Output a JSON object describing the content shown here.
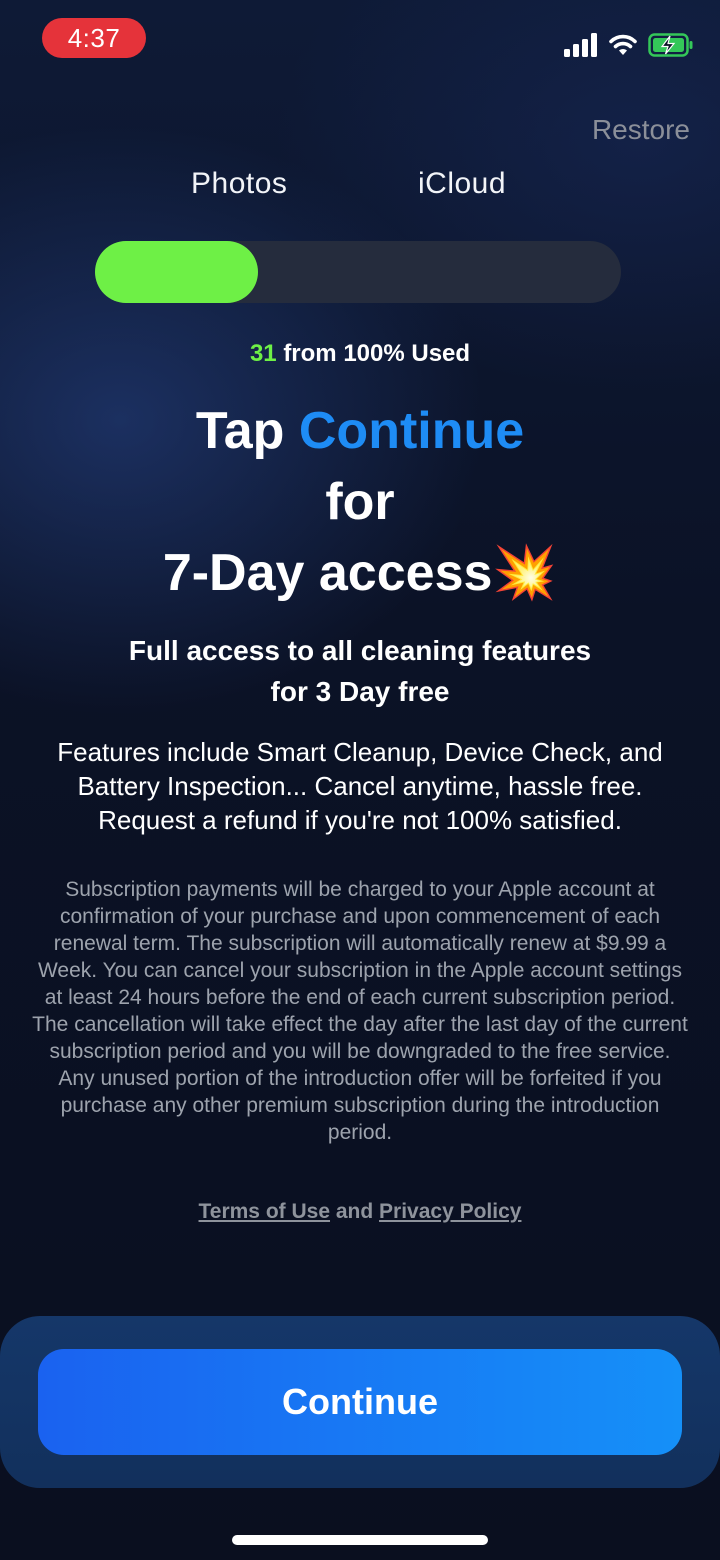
{
  "status_bar": {
    "time": "4:37",
    "icons": [
      "cellular-signal-icon",
      "wifi-icon",
      "battery-charging-icon"
    ],
    "battery_color": "#34c759"
  },
  "header": {
    "restore_label": "Restore"
  },
  "tabs": [
    {
      "label": "Photos"
    },
    {
      "label": "iCloud"
    }
  ],
  "storage": {
    "used_percent": 31,
    "used_value": "31",
    "used_suffix": "from 100% Used",
    "fill_color": "#6ef046"
  },
  "headline": {
    "prefix": "Tap ",
    "accent": "Continue",
    "line2": "for",
    "line3": "7-Day access",
    "emoji": "💥",
    "accent_color": "#1e8cf5"
  },
  "subheadline": {
    "line1": "Full access to all cleaning features",
    "line2": "for 3 Day free"
  },
  "features_text": "Features include Smart Cleanup, Device Check, and Battery Inspection... Cancel anytime, hassle free. Request a refund if you're not 100% satisfied.",
  "legal_text": "Subscription payments will be charged to your Apple account at confirmation of your purchase and upon commencement of each renewal term. The subscription will automatically renew at $9.99 a Week. You can cancel your subscription in the Apple account settings at least 24 hours before the end of each current subscription period. The cancellation will take effect the day after the last day of the current subscription period and you will be downgraded to the free service. Any unused portion of the introduction offer will be forfeited if you purchase any other premium subscription during the introduction period.",
  "links": {
    "terms": "Terms of Use",
    "joiner": " and ",
    "privacy": "Privacy Policy"
  },
  "cta": {
    "continue_label": "Continue"
  }
}
